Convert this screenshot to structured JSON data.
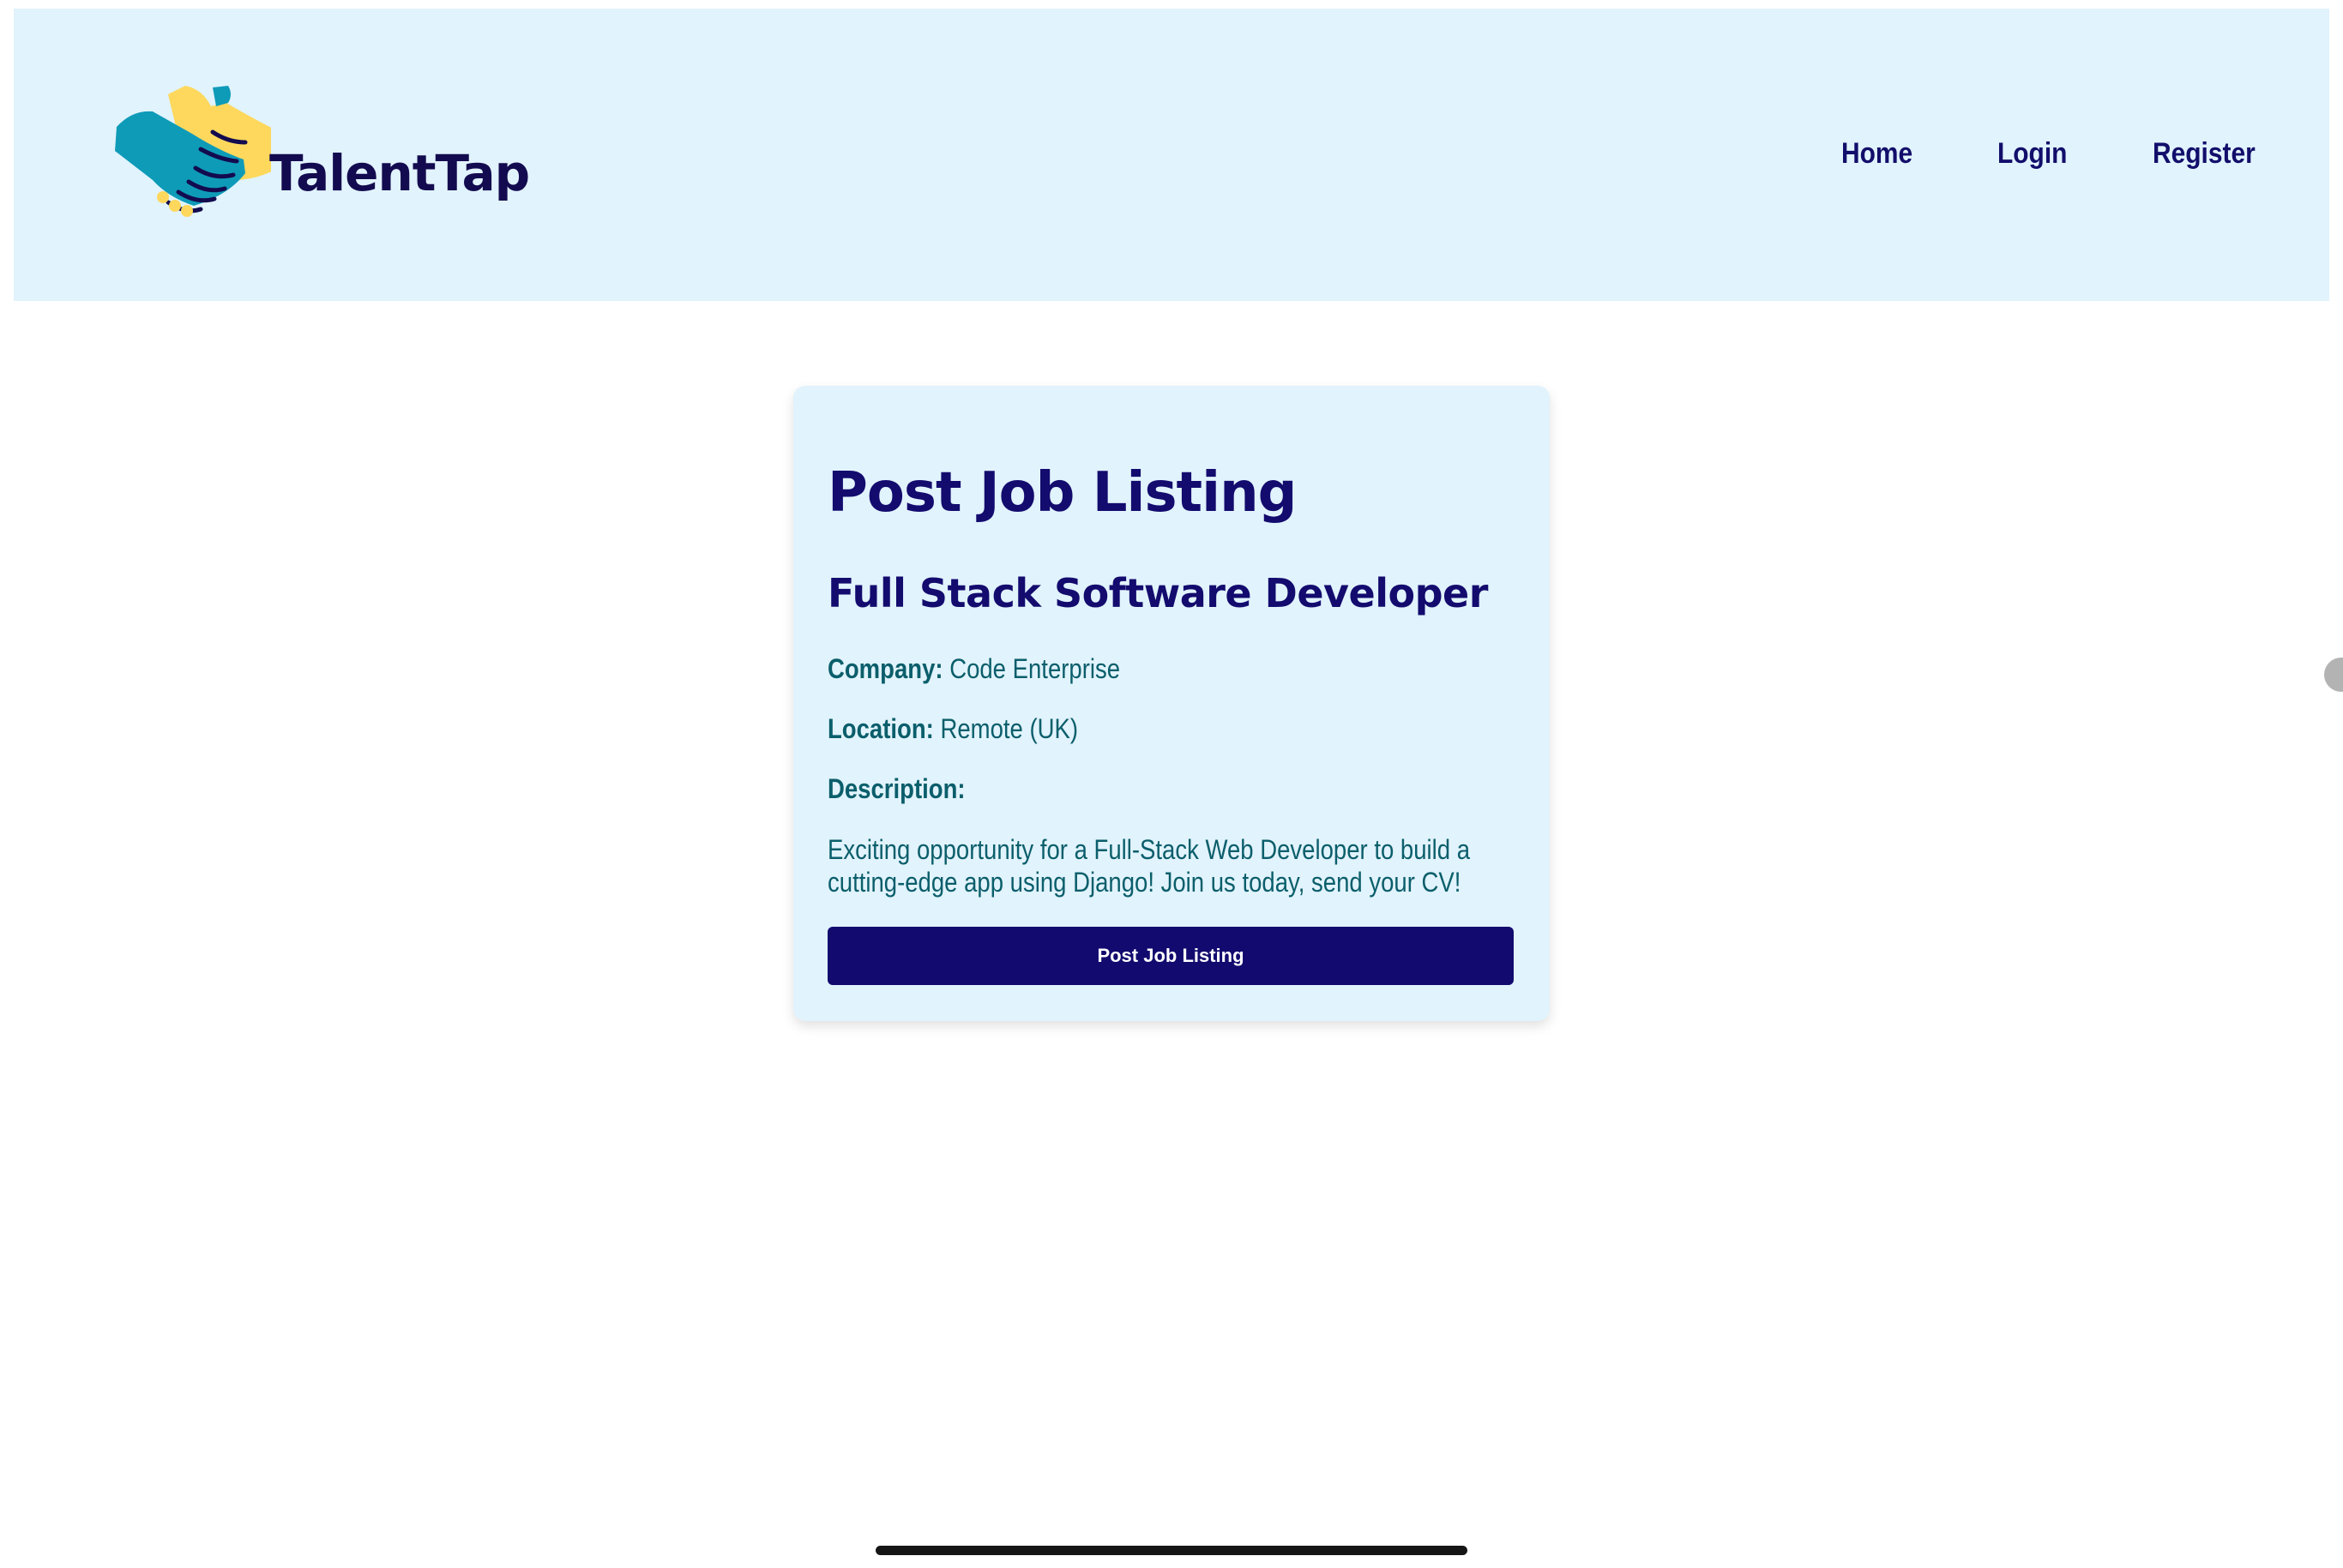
{
  "header": {
    "logo_text": "TalentTap",
    "nav": [
      {
        "label": "Home"
      },
      {
        "label": "Login"
      },
      {
        "label": "Register"
      }
    ]
  },
  "card": {
    "title": "Post Job Listing",
    "job_title": "Full Stack Software Developer",
    "company_label": "Company:",
    "company_value": "Code Enterprise",
    "location_label": "Location:",
    "location_value": "Remote (UK)",
    "description_label": "Description:",
    "description_text": "Exciting opportunity for a Full-Stack Web Developer to build a cutting-edge app using Django! Join us today, send your CV!",
    "button_label": "Post Job Listing"
  },
  "colors": {
    "header_bg": "#e1f3fc",
    "primary_navy": "#130b6e",
    "text_teal": "#0b5e6b",
    "logo_teal": "#0e9bb8",
    "logo_yellow": "#fdd85d"
  },
  "icons": {
    "logo": "handshake-icon"
  }
}
